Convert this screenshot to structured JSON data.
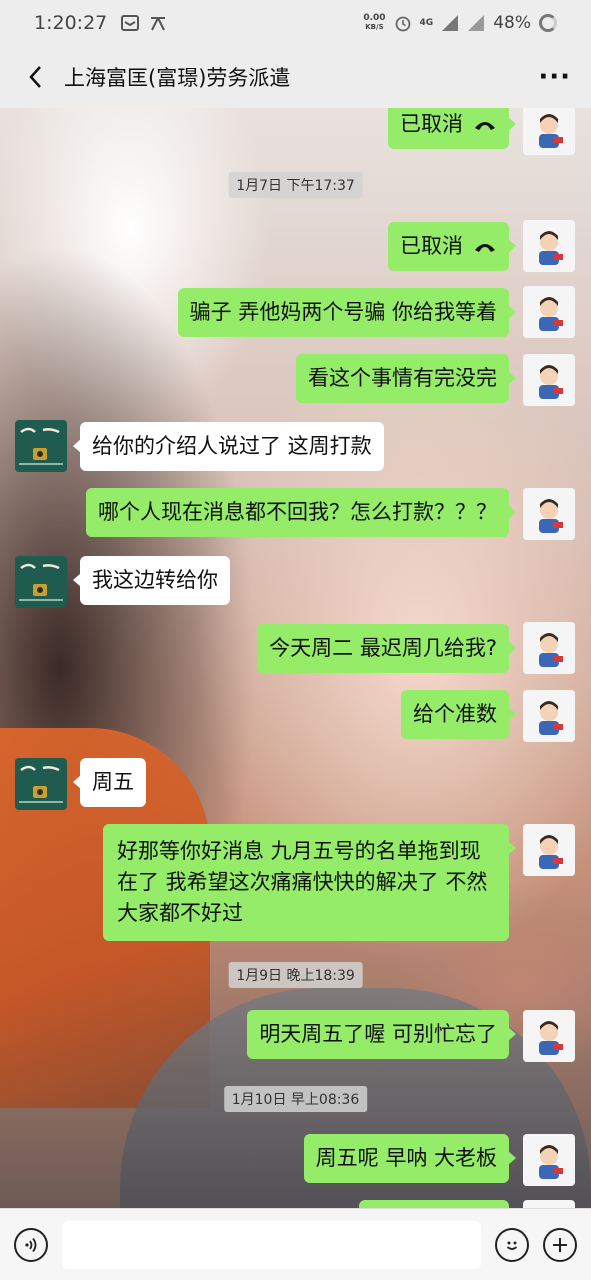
{
  "status_bar": {
    "time": "1:20:27",
    "net_speed_value": "0.00",
    "net_speed_unit": "KB/S",
    "signal_label": "4G",
    "battery": "48%"
  },
  "header": {
    "title": "上海富匡(富璟)劳务派遣",
    "more_label": "···"
  },
  "messages": [
    {
      "side": "me",
      "text": "已取消",
      "call_icon": true
    },
    {
      "type": "timestamp",
      "text": "1月7日 下午17:37"
    },
    {
      "side": "me",
      "text": "已取消",
      "call_icon": true
    },
    {
      "side": "me",
      "text": "骗子 弄他妈两个号骗 你给我等着"
    },
    {
      "side": "me",
      "text": "看这个事情有完没完"
    },
    {
      "side": "other",
      "text": "给你的介绍人说过了 这周打款"
    },
    {
      "side": "me",
      "text": "哪个人现在消息都不回我？怎么打款？？？"
    },
    {
      "side": "other",
      "text": "我这边转给你"
    },
    {
      "side": "me",
      "text": "今天周二 最迟周几给我?"
    },
    {
      "side": "me",
      "text": "给个准数"
    },
    {
      "side": "other",
      "text": "周五"
    },
    {
      "side": "me",
      "lines": [
        "好那等你好消息   九月五号的名单拖到现",
        "在了 我希望这次痛痛快快的解决了 不然",
        "大家都不好过"
      ]
    },
    {
      "type": "timestamp",
      "text": "1月9日 晚上18:39"
    },
    {
      "side": "me",
      "text": "明天周五了喔  可别忙忘了"
    },
    {
      "type": "timestamp",
      "text": "1月10日 早上08:36"
    },
    {
      "side": "me",
      "text": "周五呢 早呐 大老板"
    }
  ],
  "colors": {
    "bubble_me": "#95ec69",
    "bubble_other": "#ffffff",
    "background": "#ededed"
  },
  "icons": [
    "back-arrow-icon",
    "more-icon",
    "call-cancel-icon",
    "voice-icon",
    "emoji-icon",
    "plus-icon"
  ]
}
